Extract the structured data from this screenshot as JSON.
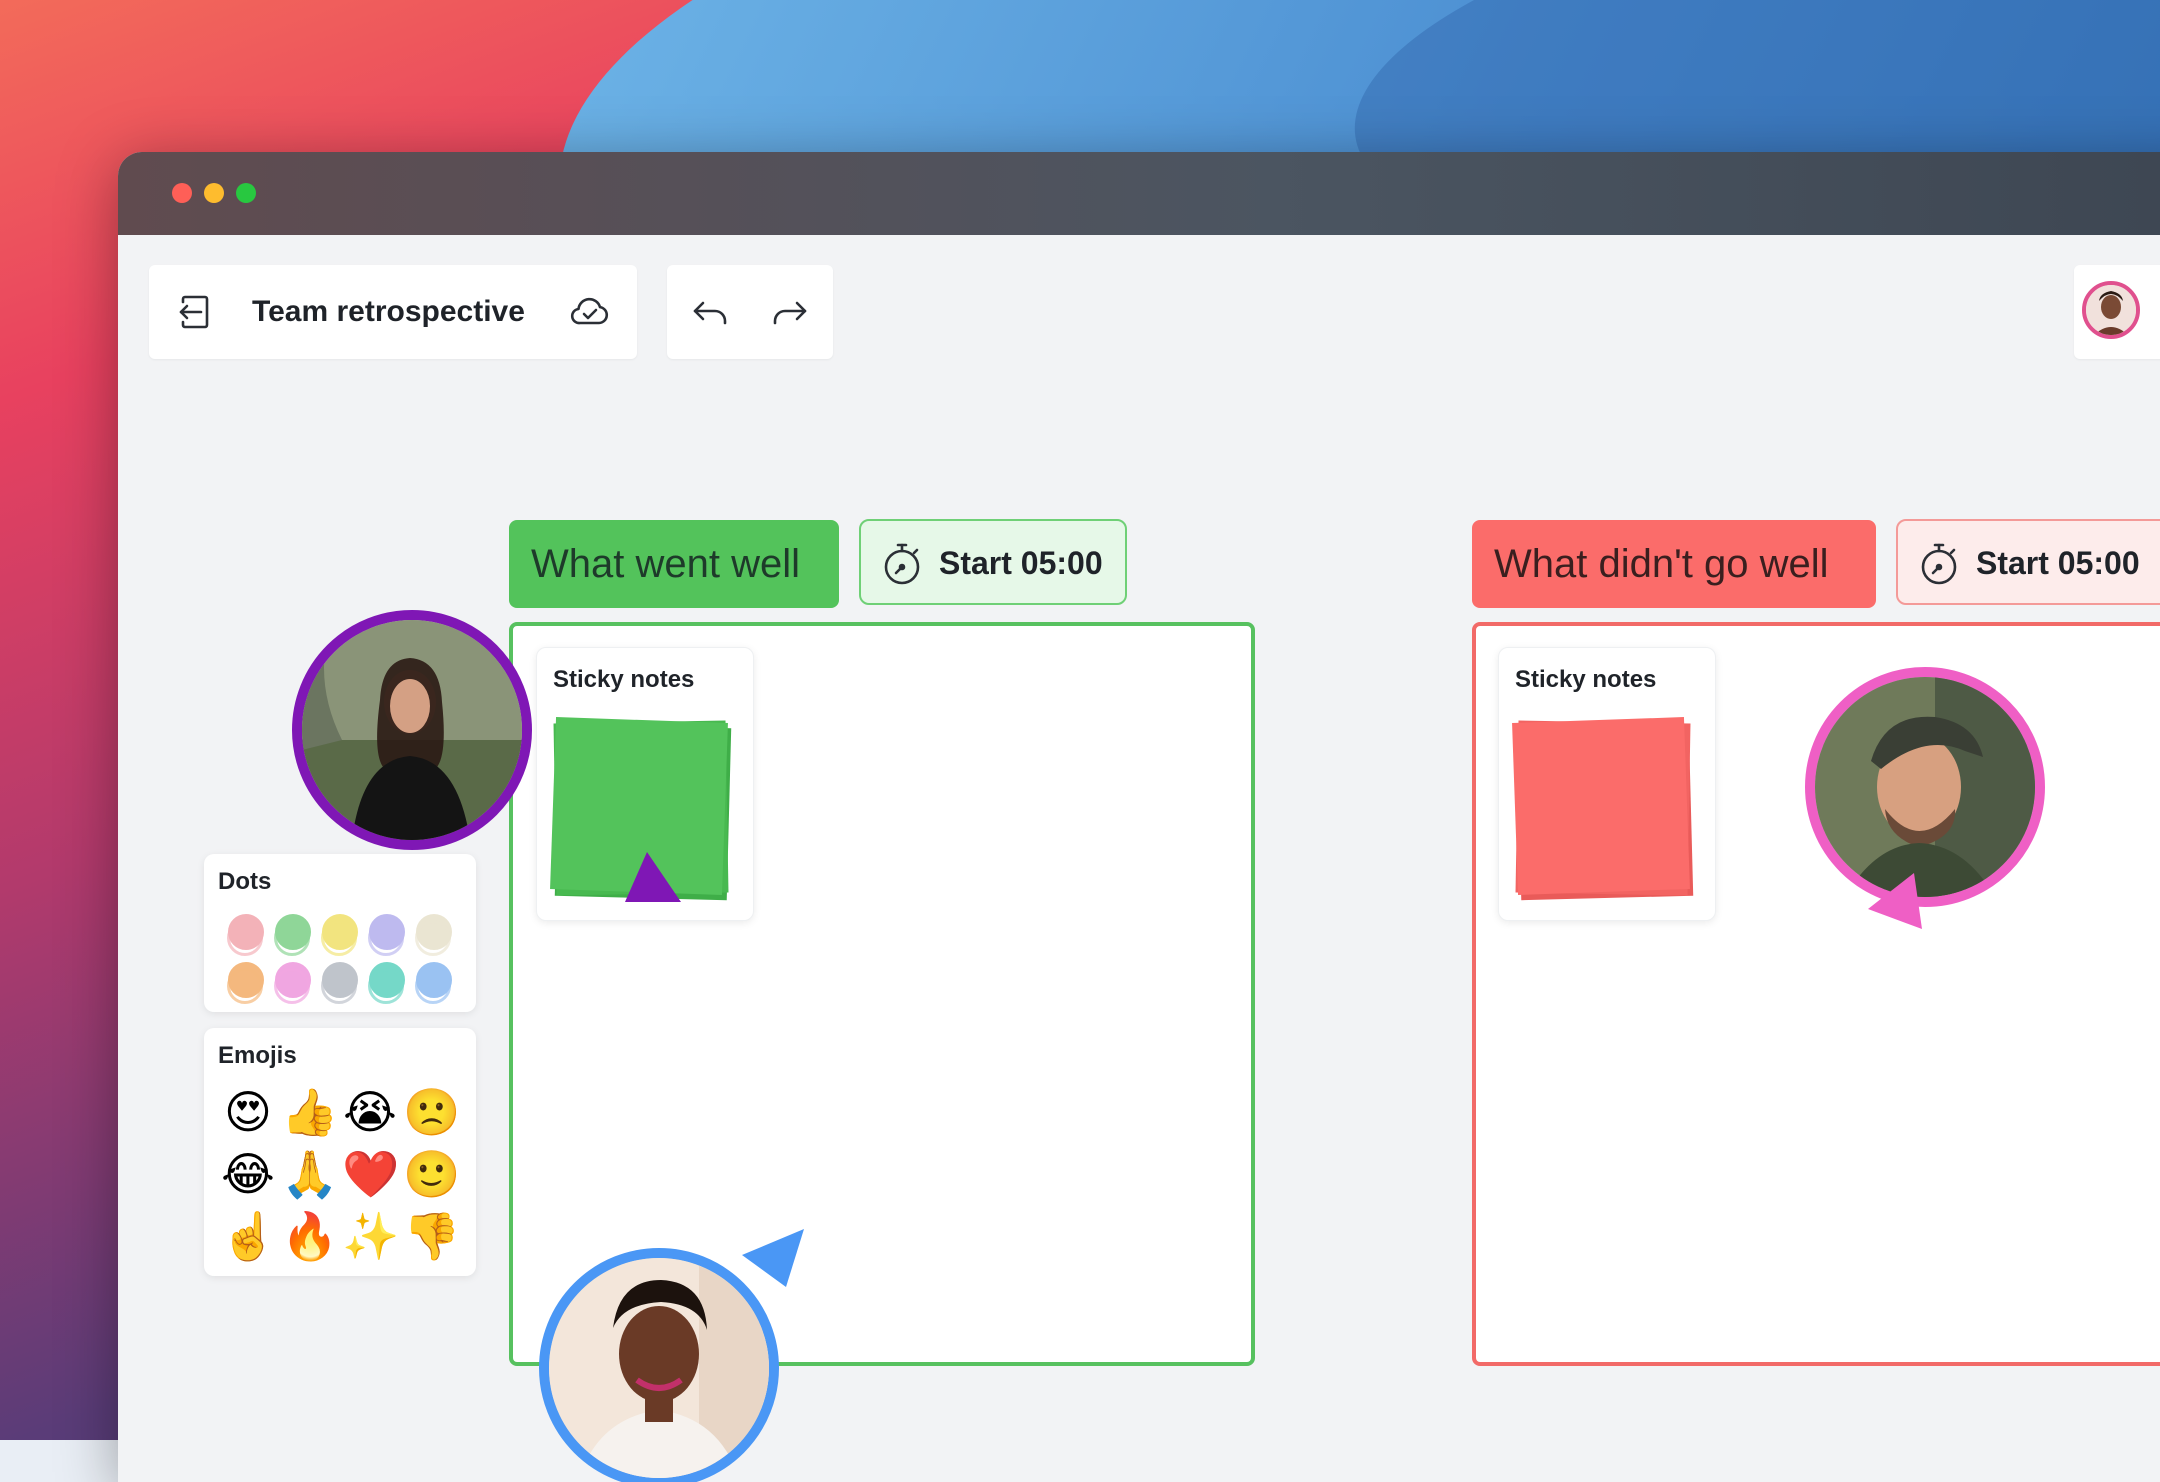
{
  "board": {
    "title": "Team retrospective"
  },
  "columns": [
    {
      "title": "What went well",
      "timer_label": "Start 05:00",
      "tool_label": "Sticky notes",
      "color": "#53c35b"
    },
    {
      "title": "What didn't go well",
      "timer_label": "Start 05:00",
      "tool_label": "Sticky notes",
      "color": "#fb6c6a"
    }
  ],
  "dots": {
    "label": "Dots",
    "colors": [
      "#f7a8b0",
      "#7fd48a",
      "#f5e56b",
      "#b7b3f2",
      "#ece6cf",
      "#f8b06a",
      "#f39ae0",
      "#b9bec7",
      "#5fd6c3",
      "#8cbcf5"
    ]
  },
  "emojis": {
    "label": "Emojis",
    "items": [
      "😍",
      "👍",
      "😭",
      "🙁",
      "😂",
      "🙏",
      "❤️",
      "🙂",
      "☝️",
      "🔥",
      "✨",
      "👎"
    ]
  },
  "collaborators": [
    {
      "cursor_color": "#7f17b5"
    },
    {
      "cursor_color": "#ef5fc5"
    },
    {
      "cursor_color": "#4a97f5"
    }
  ],
  "window_controls": [
    "close",
    "minimize",
    "zoom"
  ],
  "toolbar_icons": [
    "back-to-boards-icon",
    "cloud-saved-icon",
    "undo-icon",
    "redo-icon"
  ]
}
